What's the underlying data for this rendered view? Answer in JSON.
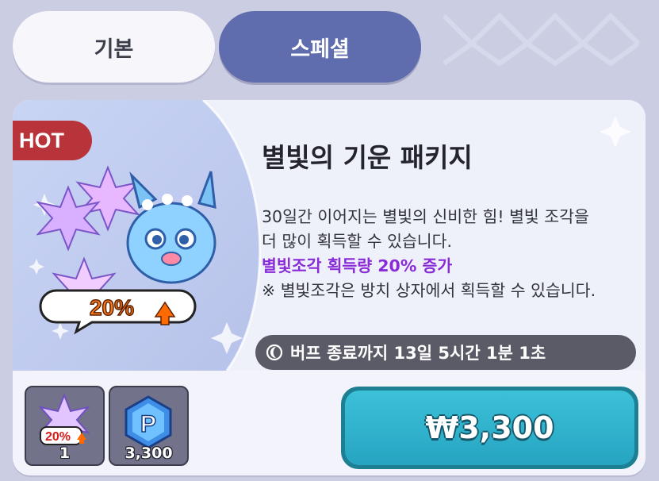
{
  "tabs": [
    {
      "label": "기본",
      "selected": false
    },
    {
      "label": "스페셜",
      "selected": true
    }
  ],
  "product": {
    "badge": "HOT",
    "title": "별빛의 기운 패키지",
    "desc_line1": "30일간 이어지는 별빛의 신비한 힘! 별빛 조각을",
    "desc_line2": "더 많이 획득할 수 있습니다.",
    "highlight": "별빛조각 획득량 20% 증가",
    "note": "※ 별빛조각은 방치 상자에서 획득할 수 있습니다.",
    "art_boost_text": "20%",
    "timer_icon": "moon-icon",
    "timer_text": "버프 종료까지 13일 5시간 1분 1초"
  },
  "rewards": [
    {
      "icon": "starlight-boost-icon",
      "qty": "1",
      "badge": "20%"
    },
    {
      "icon": "p-gem-icon",
      "qty": "3,300"
    }
  ],
  "purchase": {
    "price": "₩3,300"
  },
  "colors": {
    "tab_selected": "#5f6dae",
    "hot_badge": "#b9343a",
    "highlight_text": "#8a2bd8",
    "buy_button": "#2ba9c6"
  }
}
